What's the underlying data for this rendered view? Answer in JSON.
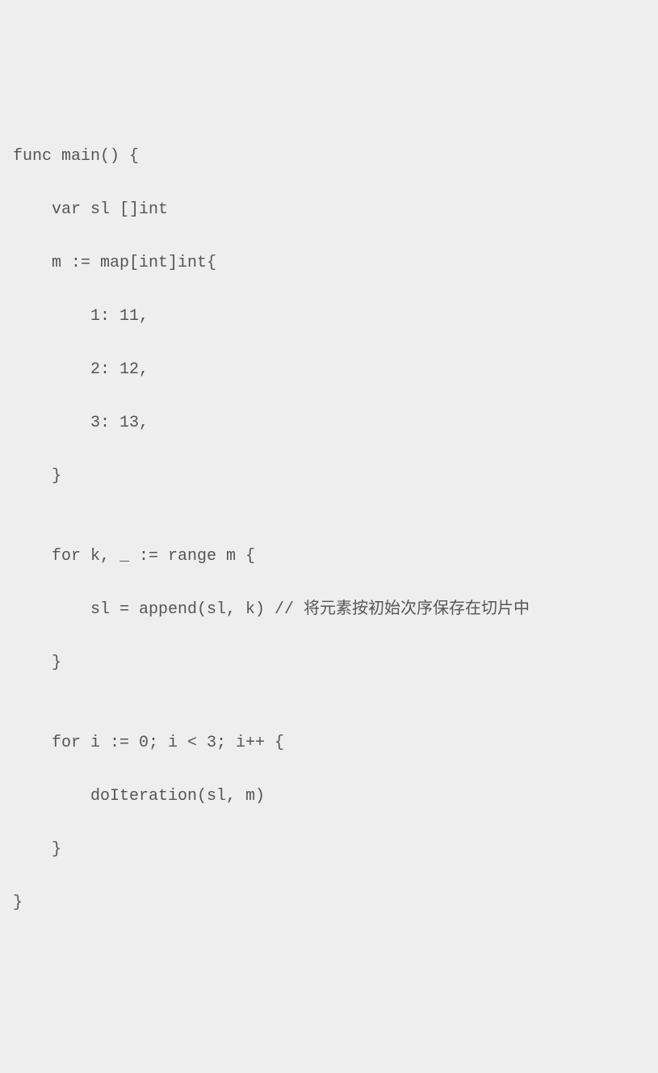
{
  "code": {
    "lines": [
      "func main() {",
      "    var sl []int",
      "    m := map[int]int{",
      "        1: 11,",
      "        2: 12,",
      "        3: 13,",
      "    }",
      "",
      "    for k, _ := range m {",
      "        sl = append(sl, k) // 将元素按初始次序保存在切片中",
      "    }",
      "",
      "    for i := 0; i < 3; i++ {",
      "        doIteration(sl, m)",
      "    }",
      "}"
    ]
  }
}
